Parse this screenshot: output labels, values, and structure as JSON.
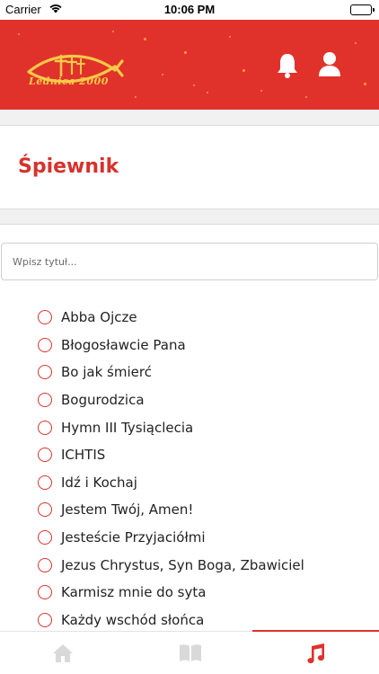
{
  "status_bar": {
    "carrier": "Carrier",
    "time": "10:06 PM"
  },
  "header": {
    "logo_text": "Lednica 2000",
    "logo_icon": "ichthys-cross-fish-logo",
    "bell_icon": "bell-icon",
    "user_icon": "user-icon",
    "accent_color": "#e0322b"
  },
  "page": {
    "title": "Śpiewnik"
  },
  "search": {
    "placeholder": "Wpisz tytuł..."
  },
  "songs": [
    "Abba Ojcze",
    "Błogosławcie Pana",
    "Bo jak śmierć",
    "Bogurodzica",
    "Hymn III Tysiąclecia",
    "ICHTIS",
    "Idź i Kochaj",
    "Jestem Twój, Amen!",
    "Jesteście Przyjaciółmi",
    "Jezus Chrystus, Syn Boga, Zbawiciel",
    "Karmisz mnie do syta",
    "Każdy wschód słońca"
  ],
  "tab_bar": {
    "tabs": [
      {
        "icon": "home-icon",
        "active": false
      },
      {
        "icon": "book-icon",
        "active": false
      },
      {
        "icon": "music-note-icon",
        "active": true
      }
    ]
  }
}
